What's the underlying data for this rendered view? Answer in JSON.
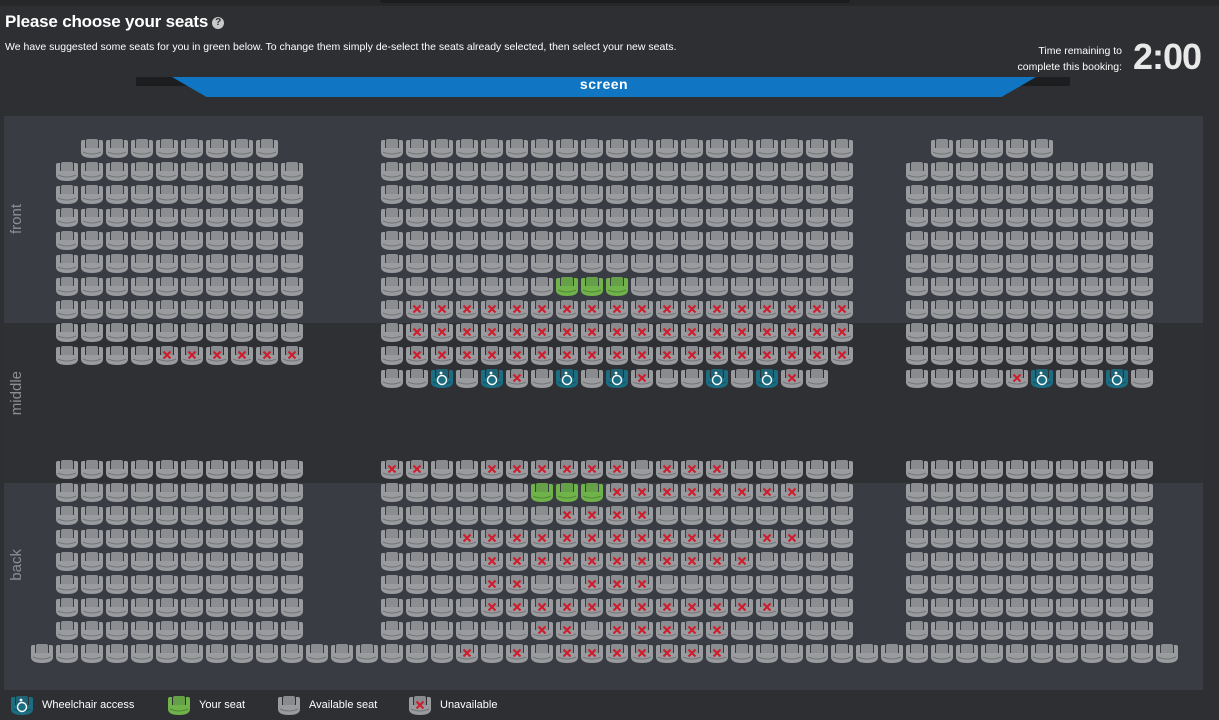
{
  "header": {
    "title": "Please choose your seats",
    "subtitle": "We have suggested some seats for you in green below. To change them simply de-select the seats already selected, then select your new seats.",
    "timer_label_line1": "Time remaining to",
    "timer_label_line2": "complete this booking:",
    "timer_value": "2:00"
  },
  "screen_label": "screen",
  "zones": {
    "front": "front",
    "middle": "middle",
    "back": "back"
  },
  "legend": {
    "wheelchair": "Wheelchair access",
    "your_seat": "Your seat",
    "available": "Available seat",
    "unavailable": "Unavailable"
  },
  "colors": {
    "available": "#9a9b9f",
    "selected": "#6fb34a",
    "wheelchair": "#1b6d82",
    "unavailable_mark": "#d11a2a",
    "screen": "#1076c4"
  },
  "icons": {
    "help": "question-circle-icon",
    "wheelchair": "wheelchair-icon",
    "unavailable": "x-mark-icon"
  }
}
